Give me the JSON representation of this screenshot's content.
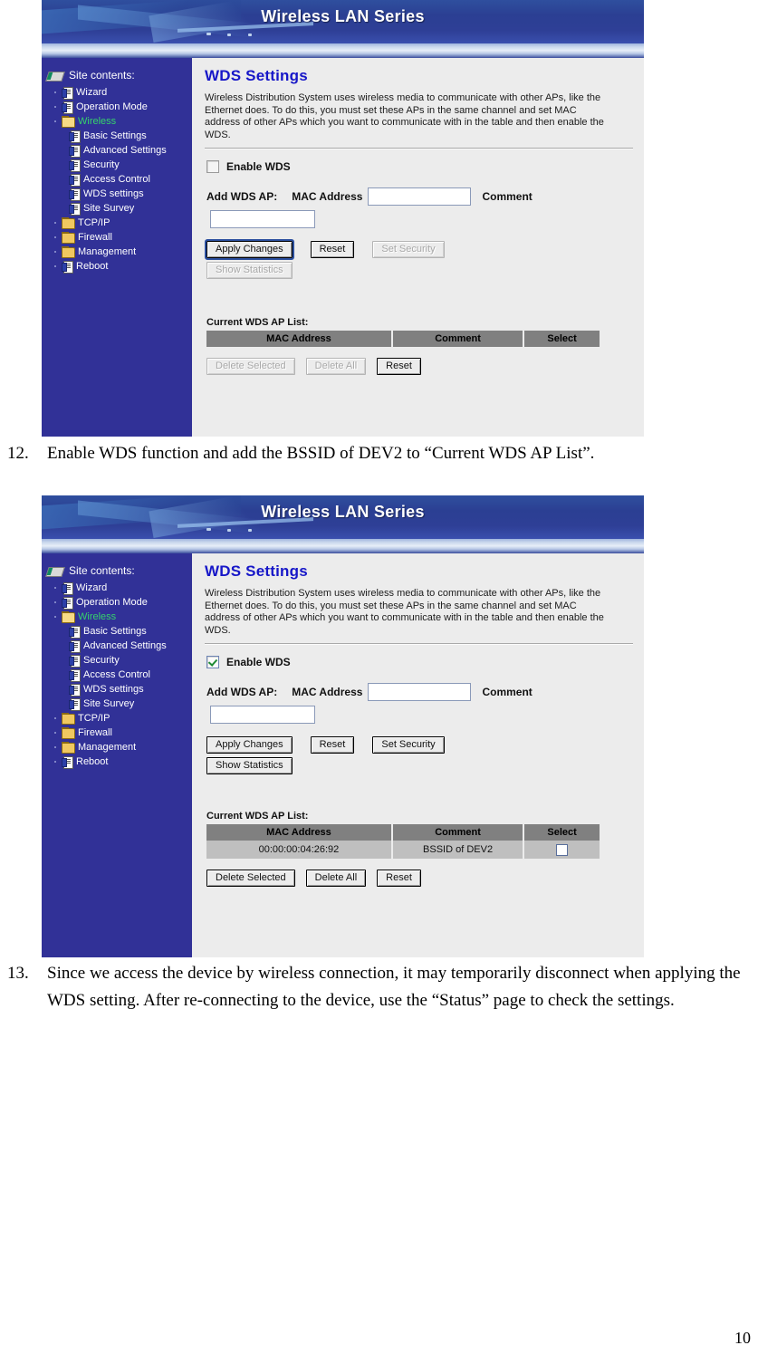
{
  "document": {
    "page_number": "10",
    "items": [
      {
        "number": "12.",
        "text": "Enable WDS function and add the BSSID of DEV2 to “Current WDS AP List”."
      },
      {
        "number": "13.",
        "text": "Since we access the device by wireless connection, it may temporarily disconnect when applying the WDS setting. After re-connecting to the device, use the “Status” page to check the settings."
      }
    ]
  },
  "screenshot1": {
    "banner": {
      "title": "Wireless LAN Series"
    },
    "sidebar": {
      "heading": "Site contents:",
      "heading_icon": "book-icon",
      "items": [
        {
          "label": "Wizard",
          "icon": "page-icon",
          "level": 1,
          "active": false
        },
        {
          "label": "Operation Mode",
          "icon": "page-icon",
          "level": 1,
          "active": false
        },
        {
          "label": "Wireless",
          "icon": "folder-open-icon",
          "level": 1,
          "active": true
        },
        {
          "label": "Basic Settings",
          "icon": "page-icon",
          "level": 2,
          "active": false
        },
        {
          "label": "Advanced Settings",
          "icon": "page-icon",
          "level": 2,
          "active": false
        },
        {
          "label": "Security",
          "icon": "page-icon",
          "level": 2,
          "active": false
        },
        {
          "label": "Access Control",
          "icon": "page-icon",
          "level": 2,
          "active": false
        },
        {
          "label": "WDS settings",
          "icon": "page-icon",
          "level": 2,
          "active": false
        },
        {
          "label": "Site Survey",
          "icon": "page-icon",
          "level": 2,
          "active": false
        },
        {
          "label": "TCP/IP",
          "icon": "folder-icon",
          "level": 1,
          "active": false
        },
        {
          "label": "Firewall",
          "icon": "folder-icon",
          "level": 1,
          "active": false
        },
        {
          "label": "Management",
          "icon": "folder-icon",
          "level": 1,
          "active": false
        },
        {
          "label": "Reboot",
          "icon": "page-icon",
          "level": 1,
          "active": false
        }
      ]
    },
    "content": {
      "title": "WDS Settings",
      "description": "Wireless Distribution System uses wireless media to communicate with other APs, like the Ethernet does. To do this, you must set these APs in the same channel and set MAC address of other APs which you want to communicate with in the table and then enable the WDS.",
      "enable_wds_label": "Enable WDS",
      "enable_wds_checked": false,
      "add_ap_label": "Add WDS AP:",
      "mac_address_label": "MAC Address",
      "comment_label": "Comment",
      "mac_address_value": "",
      "comment_value": "",
      "buttons": [
        {
          "label": "Apply Changes",
          "disabled": false,
          "focused": true
        },
        {
          "label": "Reset",
          "disabled": false,
          "focused": false
        },
        {
          "label": "Set Security",
          "disabled": true,
          "focused": false
        },
        {
          "label": "Show Statistics",
          "disabled": true,
          "focused": false
        }
      ],
      "list_label": "Current WDS AP List:",
      "table": {
        "columns": [
          "MAC Address",
          "Comment",
          "Select"
        ],
        "rows": []
      },
      "table_buttons": [
        {
          "label": "Delete Selected",
          "disabled": true
        },
        {
          "label": "Delete All",
          "disabled": true
        },
        {
          "label": "Reset",
          "disabled": false
        }
      ]
    }
  },
  "screenshot2": {
    "banner": {
      "title": "Wireless LAN Series"
    },
    "sidebar": {
      "heading": "Site contents:",
      "heading_icon": "book-icon",
      "items": [
        {
          "label": "Wizard",
          "icon": "page-icon",
          "level": 1,
          "active": false
        },
        {
          "label": "Operation Mode",
          "icon": "page-icon",
          "level": 1,
          "active": false
        },
        {
          "label": "Wireless",
          "icon": "folder-open-icon",
          "level": 1,
          "active": true
        },
        {
          "label": "Basic Settings",
          "icon": "page-icon",
          "level": 2,
          "active": false
        },
        {
          "label": "Advanced Settings",
          "icon": "page-icon",
          "level": 2,
          "active": false
        },
        {
          "label": "Security",
          "icon": "page-icon",
          "level": 2,
          "active": false
        },
        {
          "label": "Access Control",
          "icon": "page-icon",
          "level": 2,
          "active": false
        },
        {
          "label": "WDS settings",
          "icon": "page-icon",
          "level": 2,
          "active": false
        },
        {
          "label": "Site Survey",
          "icon": "page-icon",
          "level": 2,
          "active": false
        },
        {
          "label": "TCP/IP",
          "icon": "folder-icon",
          "level": 1,
          "active": false
        },
        {
          "label": "Firewall",
          "icon": "folder-icon",
          "level": 1,
          "active": false
        },
        {
          "label": "Management",
          "icon": "folder-icon",
          "level": 1,
          "active": false
        },
        {
          "label": "Reboot",
          "icon": "page-icon",
          "level": 1,
          "active": false
        }
      ]
    },
    "content": {
      "title": "WDS Settings",
      "description": "Wireless Distribution System uses wireless media to communicate with other APs, like the Ethernet does. To do this, you must set these APs in the same channel and set MAC address of other APs which you want to communicate with in the table and then enable the WDS.",
      "enable_wds_label": "Enable WDS",
      "enable_wds_checked": true,
      "add_ap_label": "Add WDS AP:",
      "mac_address_label": "MAC Address",
      "comment_label": "Comment",
      "mac_address_value": "",
      "comment_value": "",
      "buttons": [
        {
          "label": "Apply Changes",
          "disabled": false,
          "focused": false
        },
        {
          "label": "Reset",
          "disabled": false,
          "focused": false
        },
        {
          "label": "Set Security",
          "disabled": false,
          "focused": false
        },
        {
          "label": "Show Statistics",
          "disabled": false,
          "focused": false
        }
      ],
      "list_label": "Current WDS AP List:",
      "table": {
        "columns": [
          "MAC Address",
          "Comment",
          "Select"
        ],
        "rows": [
          {
            "mac_address": "00:00:00:04:26:92",
            "comment": "BSSID of DEV2",
            "selected": false
          }
        ]
      },
      "table_buttons": [
        {
          "label": "Delete Selected",
          "disabled": false
        },
        {
          "label": "Delete All",
          "disabled": false
        },
        {
          "label": "Reset",
          "disabled": false
        }
      ]
    }
  },
  "colors": {
    "banner_blue": "#2b3f93",
    "sidebar_blue": "#313197",
    "title_blue": "#1717c8",
    "active_green": "#36d36b",
    "content_gray": "#ececec",
    "table_header_gray": "#808080",
    "table_row_gray": "#bfbfbf"
  }
}
